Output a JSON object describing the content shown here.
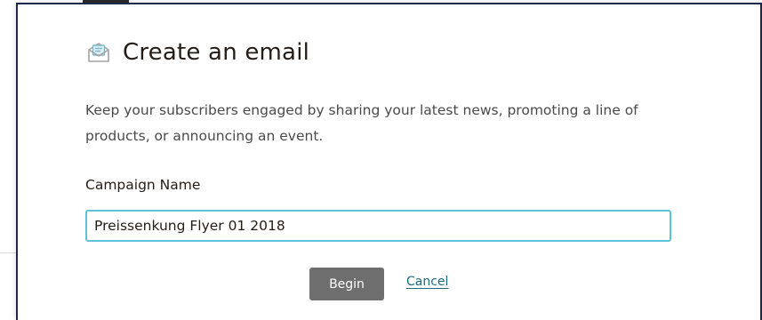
{
  "modal": {
    "title": "Create an email",
    "description": "Keep your subscribers engaged by sharing your latest news, promoting a line of products, or announcing an event.",
    "campaign_name": {
      "label": "Campaign Name",
      "value": "Preissenkung Flyer 01 2018"
    },
    "actions": {
      "begin_label": "Begin",
      "cancel_label": "Cancel"
    }
  },
  "icons": {
    "header": "email-envelope-icon"
  },
  "colors": {
    "input_focus_border": "#5ec2d6",
    "primary_button_bg": "#6e6e6e",
    "link": "#1b6b85",
    "text": "#241c15"
  }
}
